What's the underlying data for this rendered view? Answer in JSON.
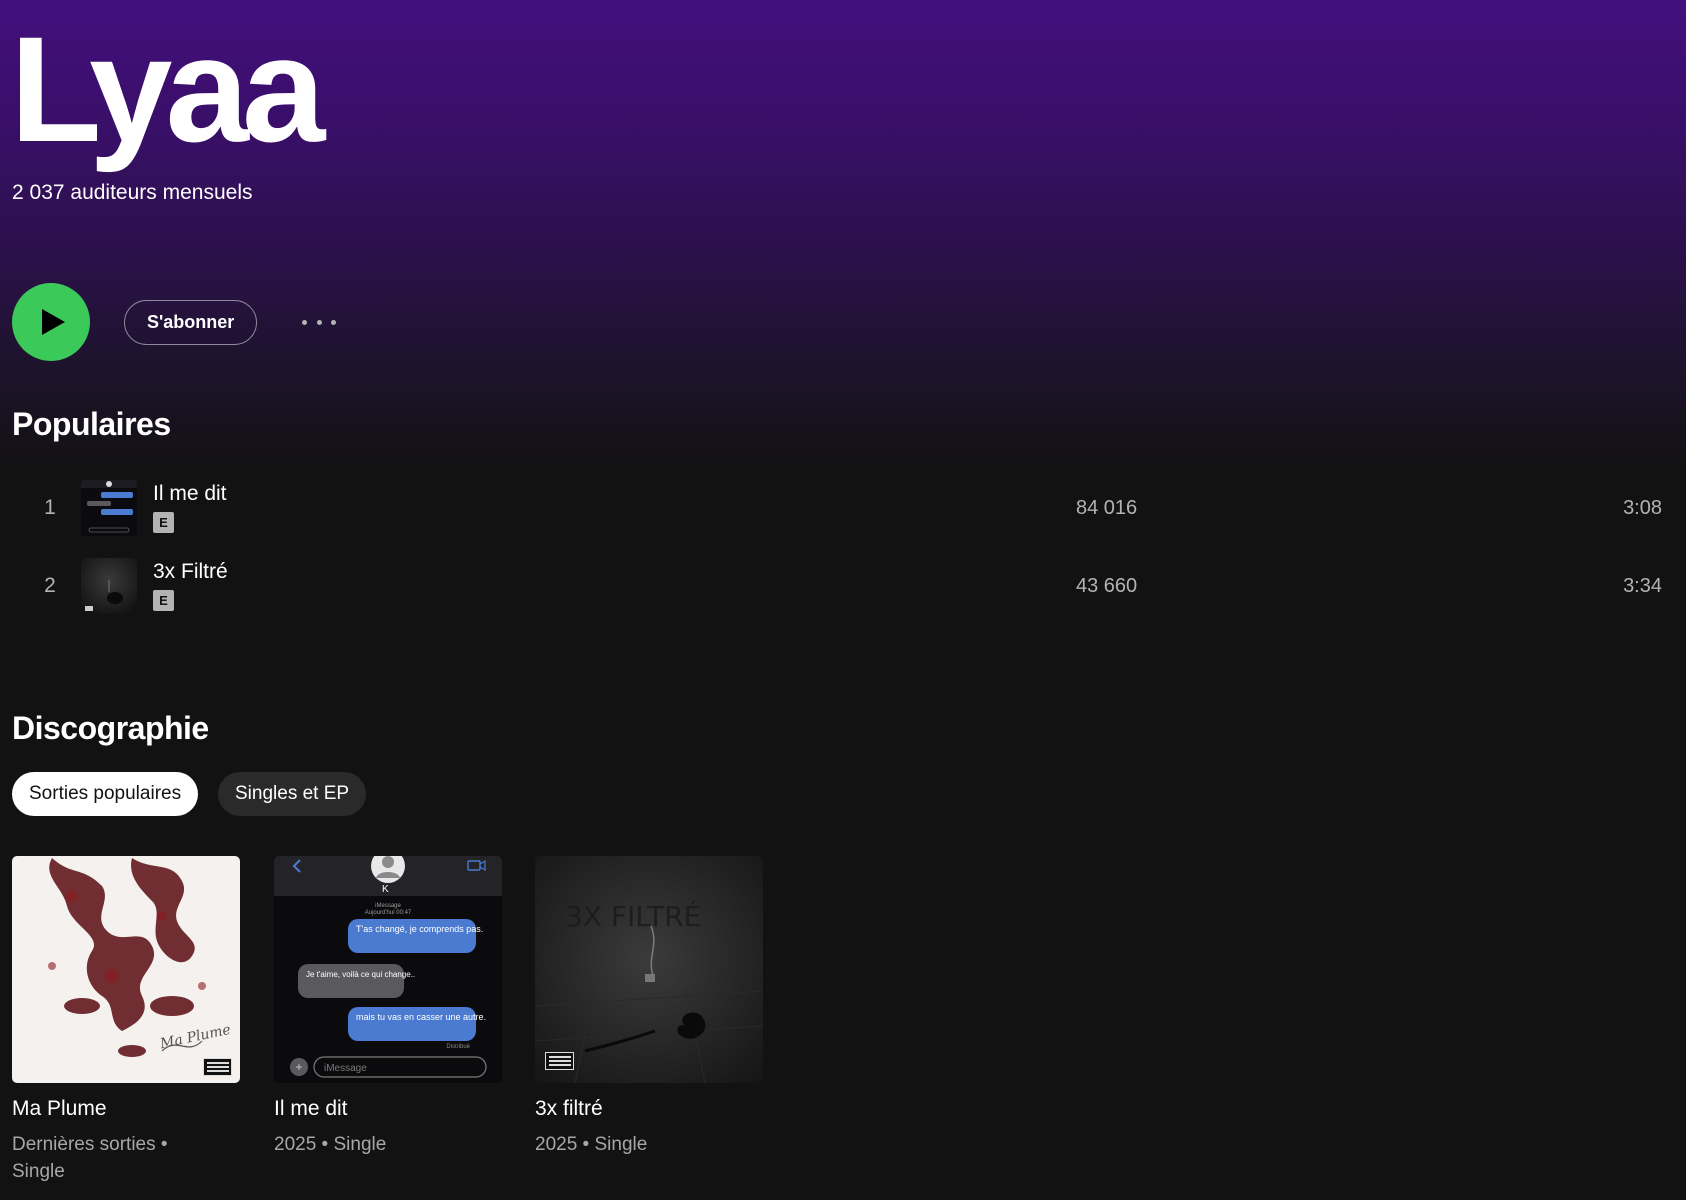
{
  "artist": {
    "name": "Lyaa",
    "listeners": "2 037 auditeurs mensuels"
  },
  "actions": {
    "play_icon": "play-icon",
    "follow_label": "S'abonner",
    "more_icon": "more-dots-icon"
  },
  "popular": {
    "title": "Populaires",
    "tracks": [
      {
        "index": "1",
        "title": "Il me dit",
        "explicit": "E",
        "plays": "84 016",
        "duration": "3:08"
      },
      {
        "index": "2",
        "title": "3x Filtré",
        "explicit": "E",
        "plays": "43 660",
        "duration": "3:34"
      }
    ]
  },
  "discography": {
    "title": "Discographie",
    "filters": [
      {
        "label": "Sorties populaires",
        "active": true
      },
      {
        "label": "Singles et EP",
        "active": false
      }
    ],
    "releases": [
      {
        "title": "Ma Plume",
        "subtitle": "Dernières sorties • Single",
        "cover_text": "Ma Plume"
      },
      {
        "title": "Il me dit",
        "subtitle": "2025 • Single",
        "cover_name": "K",
        "cover_meta": "iMessage",
        "cover_date": "Aujourd'hui 00:47",
        "bubble_1": "T'as changé, je comprends pas.",
        "bubble_2": "Je t'aime, voilà ce qui change..",
        "bubble_3": "mais tu vas en casser une autre.",
        "cover_status": "Distribué",
        "cover_placeholder": "iMessage"
      },
      {
        "title": "3x filtré",
        "subtitle": "2025 • Single",
        "cover_text": "3X FILTRÉ"
      }
    ]
  },
  "colors": {
    "accent_green": "#3bc95a",
    "hero_purple": "#430f7d",
    "background": "#121212",
    "imessage_blue": "#4a7bd1"
  }
}
